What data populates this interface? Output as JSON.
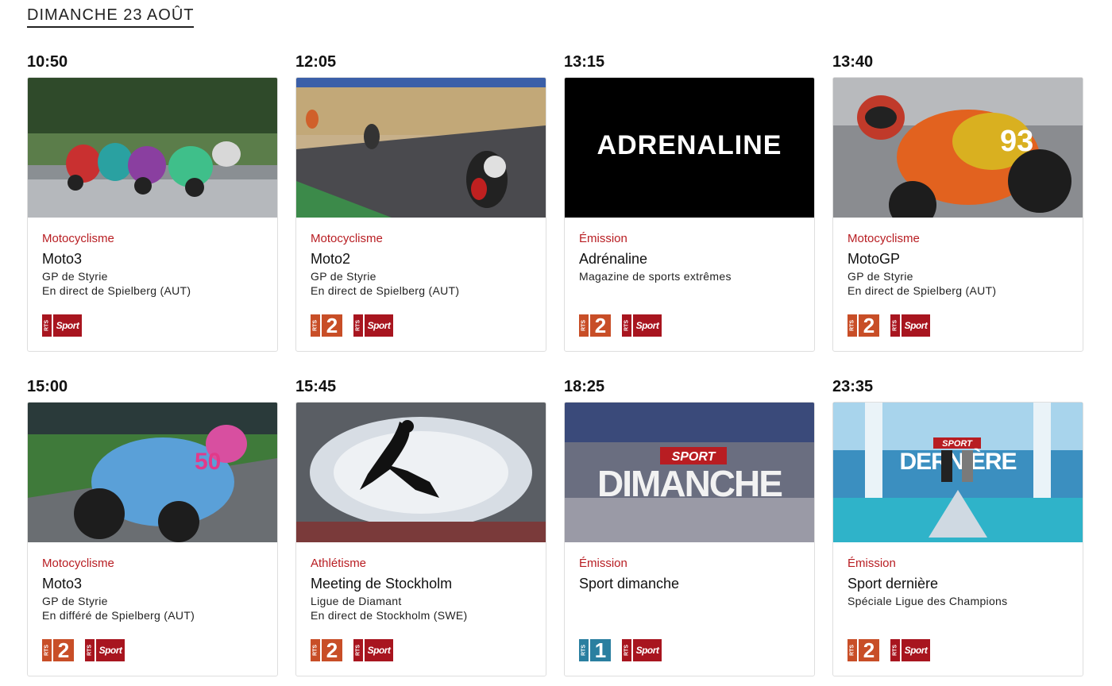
{
  "day_title": "DIMANCHE 23 AOÛT",
  "logos": {
    "rts": "RTS",
    "one": "1",
    "two": "2",
    "sport": "Sport"
  },
  "colors": {
    "category": "#b81d22",
    "rts2": "#c84e27",
    "rtssport": "#a8151f",
    "rts1": "#2a7fa0"
  },
  "programs": [
    {
      "time": "10:50",
      "category": "Motocyclisme",
      "title": "Moto3",
      "desc1": "GP de Styrie",
      "desc2": "En direct de Spielberg (AUT)",
      "channels": [
        "rts-sport"
      ],
      "thumb": "moto3-race-photo"
    },
    {
      "time": "12:05",
      "category": "Motocyclisme",
      "title": "Moto2",
      "desc1": "GP de Styrie",
      "desc2": "En direct de Spielberg (AUT)",
      "channels": [
        "rts-2",
        "rts-sport"
      ],
      "thumb": "moto2-race-photo"
    },
    {
      "time": "13:15",
      "category": "Émission",
      "title": "Adrénaline",
      "desc1": "Magazine de sports extrêmes",
      "desc2": "",
      "channels": [
        "rts-2",
        "rts-sport"
      ],
      "thumb": "adrenaline-logo",
      "thumb_text": "ADRENALINE"
    },
    {
      "time": "13:40",
      "category": "Motocyclisme",
      "title": "MotoGP",
      "desc1": "GP de Styrie",
      "desc2": "En direct de Spielberg (AUT)",
      "channels": [
        "rts-2",
        "rts-sport"
      ],
      "thumb": "motogp-rider-photo"
    },
    {
      "time": "15:00",
      "category": "Motocyclisme",
      "title": "Moto3",
      "desc1": "GP de Styrie",
      "desc2": "En différé de Spielberg (AUT)",
      "channels": [
        "rts-2",
        "rts-sport"
      ],
      "thumb": "moto3-rider-photo"
    },
    {
      "time": "15:45",
      "category": "Athlétisme",
      "title": "Meeting de Stockholm",
      "desc1": "Ligue de Diamant",
      "desc2": "En direct de Stockholm (SWE)",
      "channels": [
        "rts-2",
        "rts-sport"
      ],
      "thumb": "stadium-jumper-photo"
    },
    {
      "time": "18:25",
      "category": "Émission",
      "title": "Sport dimanche",
      "desc1": "",
      "desc2": "",
      "channels": [
        "rts-1",
        "rts-sport"
      ],
      "thumb": "sport-dimanche-studio",
      "thumb_text": "DIMANCHE",
      "thumb_small": "SPORT"
    },
    {
      "time": "23:35",
      "category": "Émission",
      "title": "Sport dernière",
      "desc1": "Spéciale Ligue des Champions",
      "desc2": "",
      "channels": [
        "rts-2",
        "rts-sport"
      ],
      "thumb": "sport-derniere-studio",
      "thumb_text": "DERNIÈRE",
      "thumb_small": "SPORT"
    }
  ]
}
